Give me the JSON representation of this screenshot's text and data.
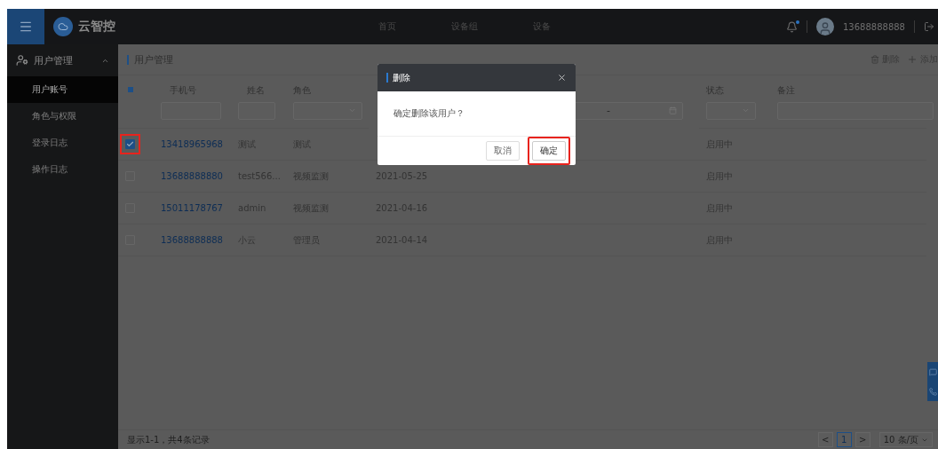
{
  "top_bar": {
    "brand": "云智控",
    "nav": [
      {
        "label": "首页",
        "selected": false
      },
      {
        "label": "设备组",
        "selected": false
      },
      {
        "label": "设备",
        "selected": false
      }
    ],
    "notification": true,
    "user": "13688888888"
  },
  "sidebar": {
    "group": {
      "label": "用户管理",
      "expanded": true
    },
    "items": [
      {
        "label": "用户账号",
        "selected": true
      },
      {
        "label": "角色与权限",
        "selected": false
      },
      {
        "label": "登录日志",
        "selected": false
      },
      {
        "label": "操作日志",
        "selected": false
      }
    ]
  },
  "page": {
    "title": "用户管理",
    "actions": [
      {
        "kind": "delete",
        "label": "删除"
      },
      {
        "kind": "add",
        "label": "添加"
      }
    ]
  },
  "table": {
    "select_all": {
      "partial": true
    },
    "columns": [
      {
        "label": "手机号",
        "filter": {
          "kind": "text"
        }
      },
      {
        "label": "姓名",
        "filter": {
          "kind": "text"
        }
      },
      {
        "label": "角色",
        "filter": {
          "kind": "select"
        }
      },
      {
        "filter": {
          "kind": "date_range",
          "separator": "-"
        }
      },
      {
        "label": "状态",
        "filter": {
          "kind": "select"
        }
      },
      {
        "label": "备注",
        "filter": {
          "kind": "text"
        }
      }
    ],
    "rows": [
      {
        "checked": true,
        "highlighted": true,
        "phone": "13418965968",
        "name": "测试",
        "role": "测试",
        "status": "启用中"
      },
      {
        "checked": false,
        "highlighted": false,
        "phone": "13688888880",
        "name": "test566...",
        "role": "视频监测",
        "date": "2021-05-25",
        "status": "启用中"
      },
      {
        "checked": false,
        "highlighted": false,
        "phone": "15011178767",
        "name": "admin",
        "role": "视频监测",
        "date": "2021-04-16",
        "status": "启用中"
      },
      {
        "checked": false,
        "highlighted": false,
        "phone": "13688888888",
        "name": "小云",
        "role": "管理员",
        "date": "2021-04-14",
        "status": "启用中"
      }
    ]
  },
  "footer": {
    "summary": "显示1-1，共4条记录",
    "prev": "<",
    "pages": [
      {
        "label": "1",
        "selected": true
      }
    ],
    "next": ">",
    "page_size": "10 条/页"
  },
  "dialog": {
    "title": "删除",
    "message": "确定删除该用户？",
    "buttons": [
      {
        "kind": "default",
        "label": "取消",
        "highlighted": false
      },
      {
        "kind": "primary",
        "label": "确定",
        "highlighted": true
      }
    ]
  }
}
